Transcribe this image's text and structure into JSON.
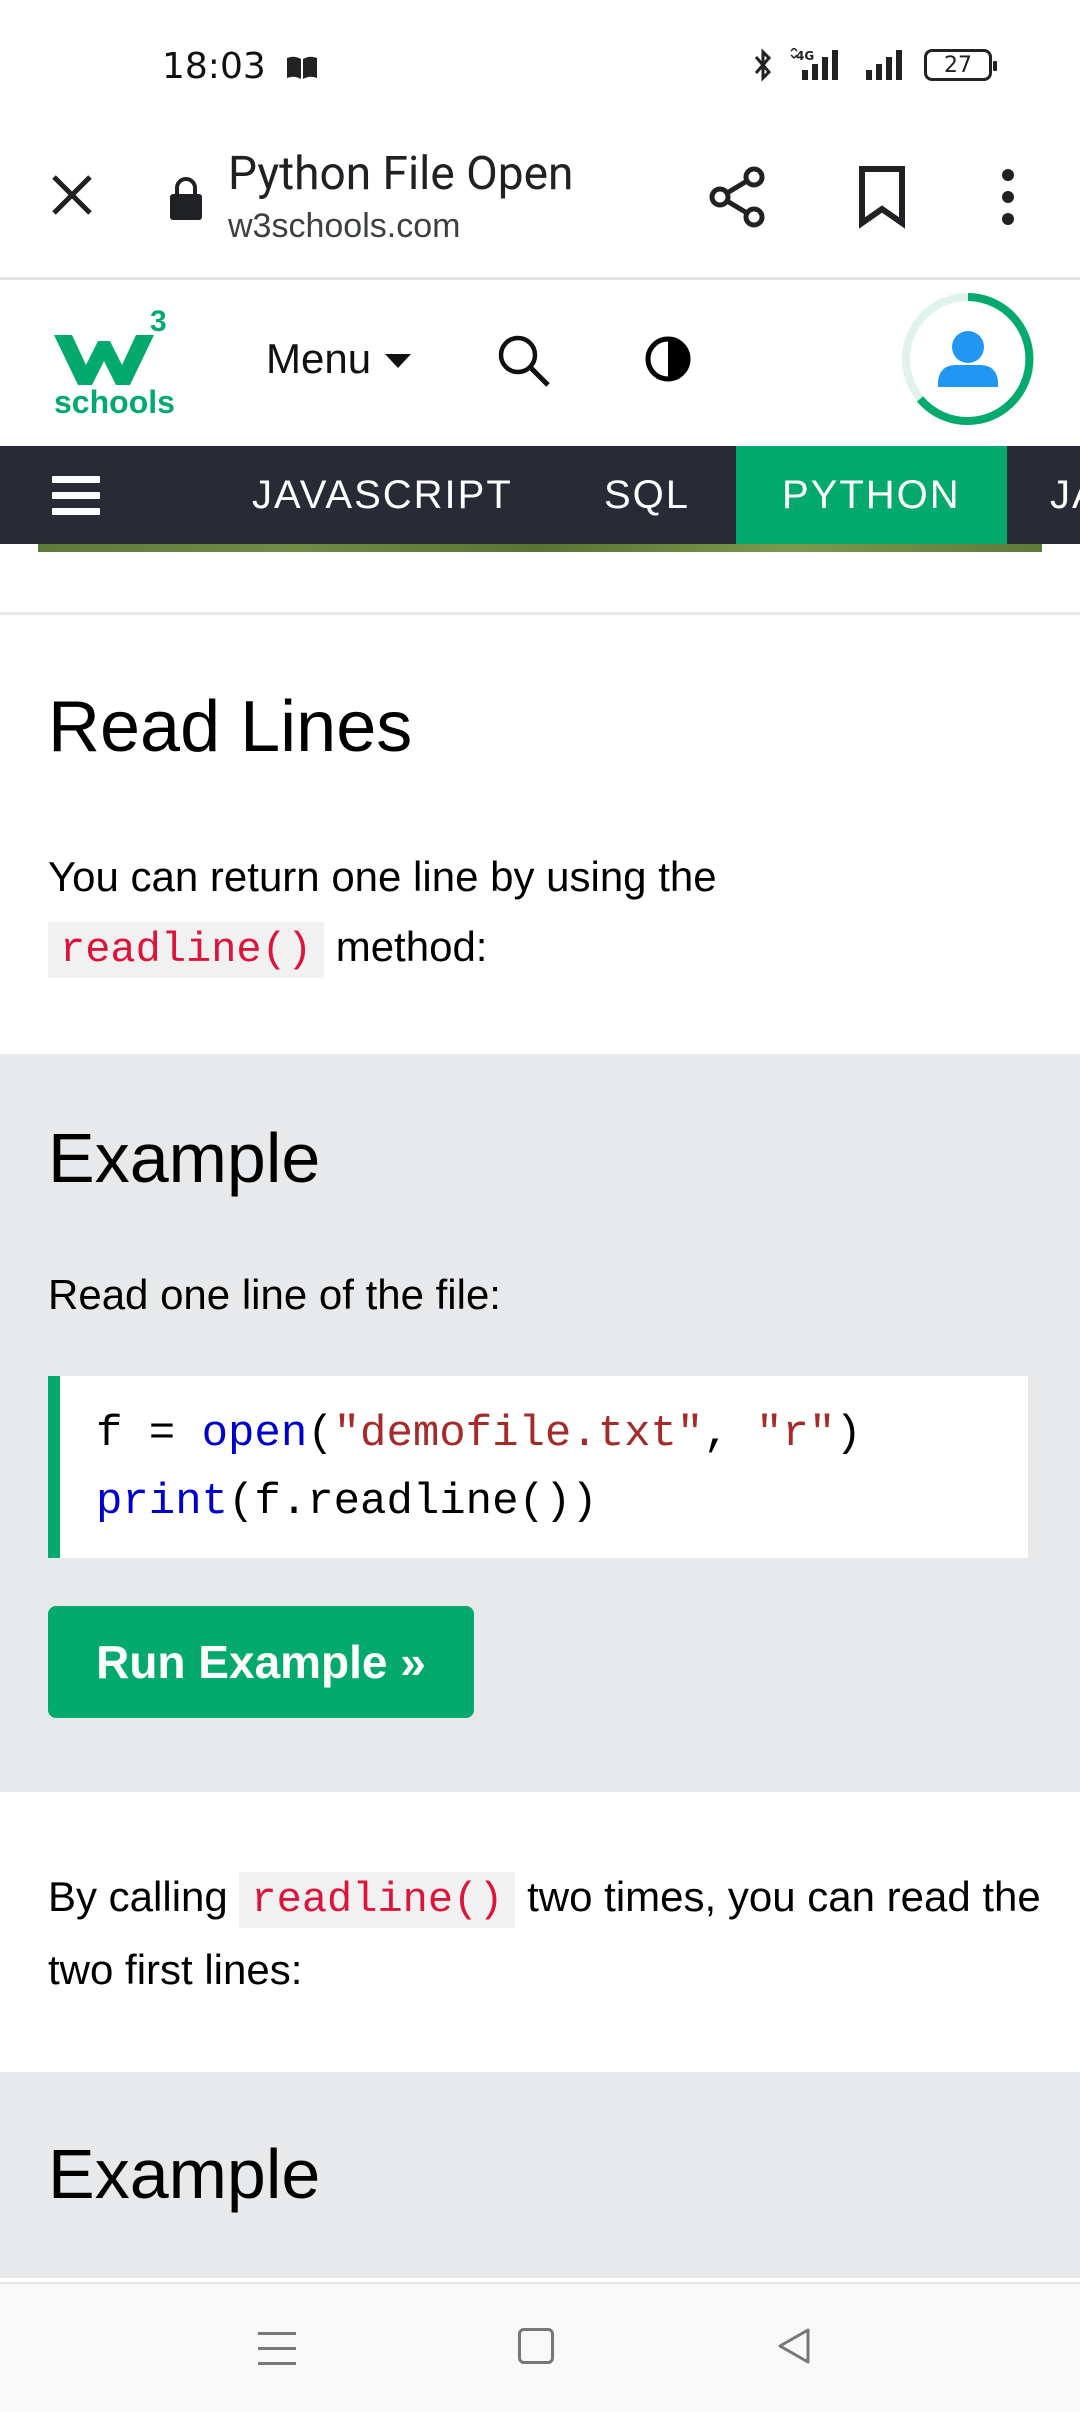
{
  "status_bar": {
    "time": "18:03",
    "battery": "27",
    "icons": [
      "book-icon",
      "bluetooth-icon",
      "4g-signal-icon",
      "signal-icon",
      "battery-icon"
    ]
  },
  "browser": {
    "title": "Python File Open",
    "url": "w3schools.com",
    "icons": [
      "close-icon",
      "lock-icon",
      "share-icon",
      "bookmark-icon",
      "more-vert-icon"
    ]
  },
  "header": {
    "logo_sup": "3",
    "logo_text": "schools",
    "menu_label": "Menu",
    "accent": "#04aa6d"
  },
  "top_nav": {
    "items": [
      "JAVASCRIPT",
      "SQL",
      "PYTHON",
      "JA"
    ],
    "active": "PYTHON",
    "background": "#282a35"
  },
  "section1": {
    "heading": "Read Lines",
    "para_before": "You can return one line by using the",
    "code": "readline()",
    "para_after": " method:"
  },
  "example1": {
    "heading": "Example",
    "description": "Read one line of the file:",
    "code_line1": {
      "var": "f = ",
      "fn": "open",
      "p1": "(",
      "s1": "\"demofile.txt\"",
      "comma": ", ",
      "s2": "\"r\"",
      "p2": ")"
    },
    "code_line2": {
      "fn": "print",
      "rest": "(f.readline())"
    },
    "button": "Run Example »"
  },
  "section2": {
    "para_before": "By calling ",
    "code": "readline()",
    "para_after": " two times, you can read the two first lines:"
  },
  "example2": {
    "heading": "Example"
  }
}
